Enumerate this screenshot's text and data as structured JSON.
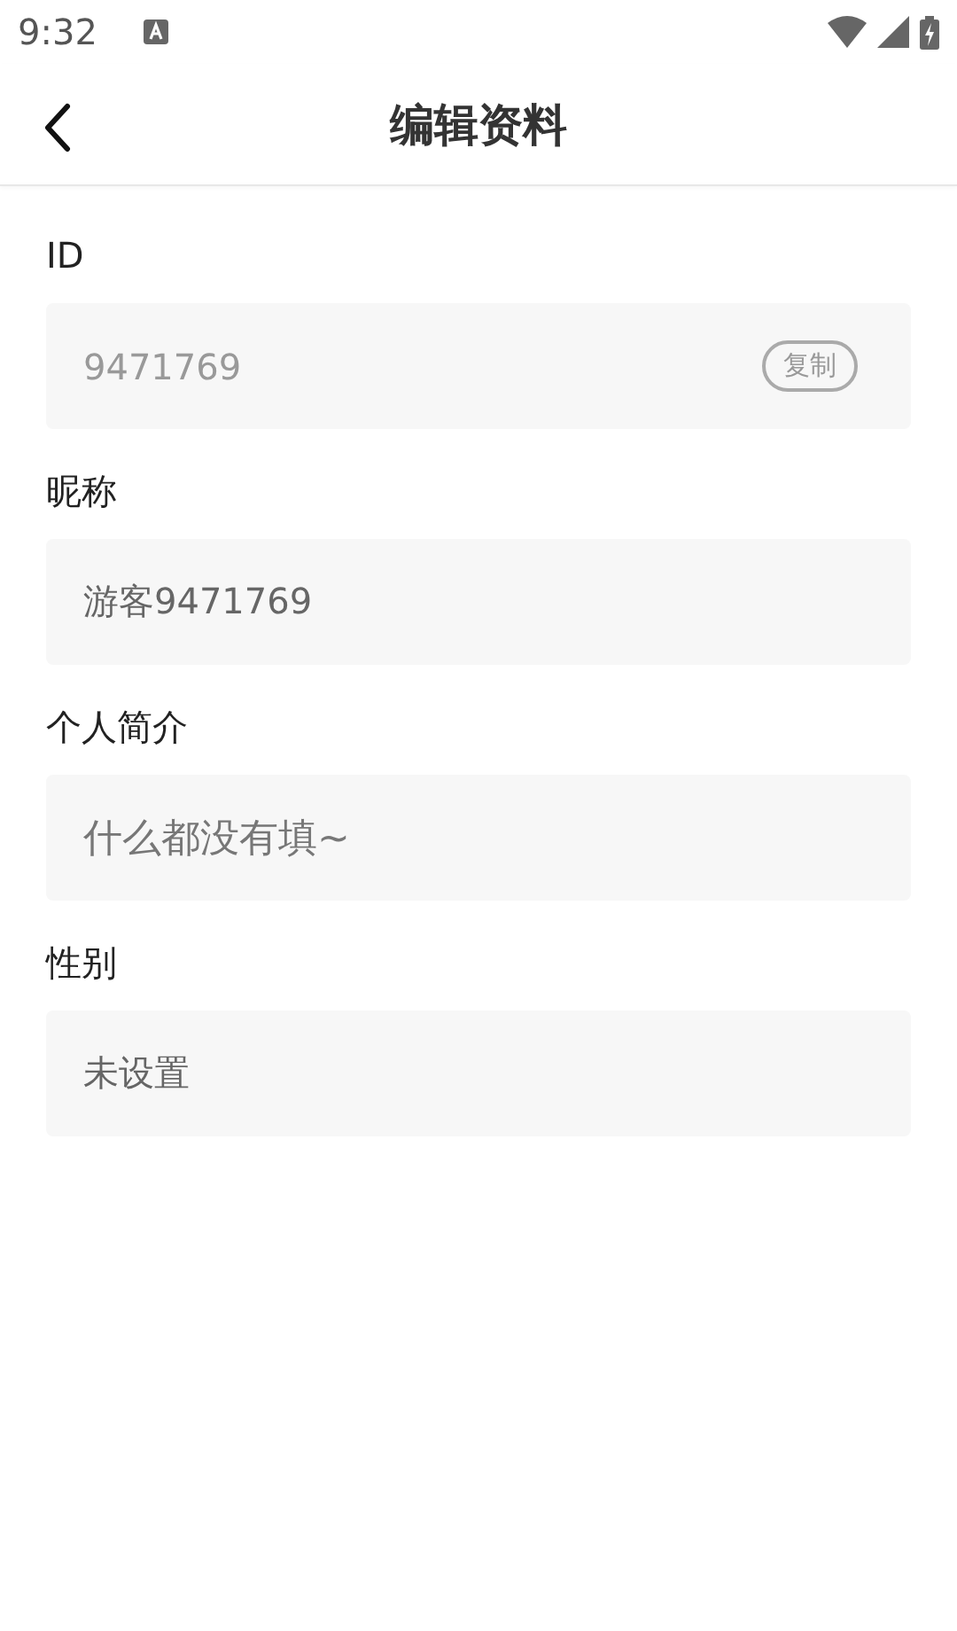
{
  "status_bar": {
    "time": "9:32"
  },
  "header": {
    "title": "编辑资料"
  },
  "fields": [
    {
      "label": "ID",
      "kind": "readonly",
      "value": "9471769",
      "action": "复制"
    },
    {
      "label": "昵称",
      "kind": "text",
      "value": "游客9471769"
    },
    {
      "label": "个人简介",
      "kind": "text",
      "placeholder": "什么都没有填~"
    },
    {
      "label": "性别",
      "kind": "select",
      "value": "未设置"
    }
  ]
}
